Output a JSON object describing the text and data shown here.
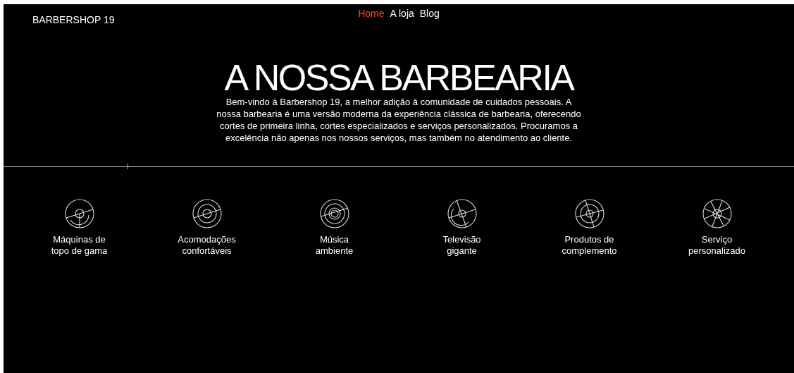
{
  "header": {
    "brand": "BARBERSHOP 19",
    "nav": [
      {
        "label": "Home",
        "selected": true
      },
      {
        "label": "A loja",
        "selected": false
      },
      {
        "label": "Blog",
        "selected": false
      }
    ]
  },
  "hero": {
    "title": "A NOSSA BARBEARIA",
    "text": "Bem-vindo à Barbershop 19, a melhor adição à comunidade de cuidados pessoais. A nossa barbearia é uma versão moderna da experiência clássica de barbearia, oferecendo cortes de primeira linha, cortes especializados e serviços personalizados. Procuramos a excelência não apenas nos nossos serviços, mas também no atendimento ao cliente."
  },
  "features": [
    {
      "label": "Máquinas de\ntopo de gama"
    },
    {
      "label": "Acomodações\nconfortáveis"
    },
    {
      "label": "Música\nambiente"
    },
    {
      "label": "Televisão\ngigante"
    },
    {
      "label": "Produtos de\ncomplemento"
    },
    {
      "label": "Serviço\npersonalizado"
    }
  ]
}
